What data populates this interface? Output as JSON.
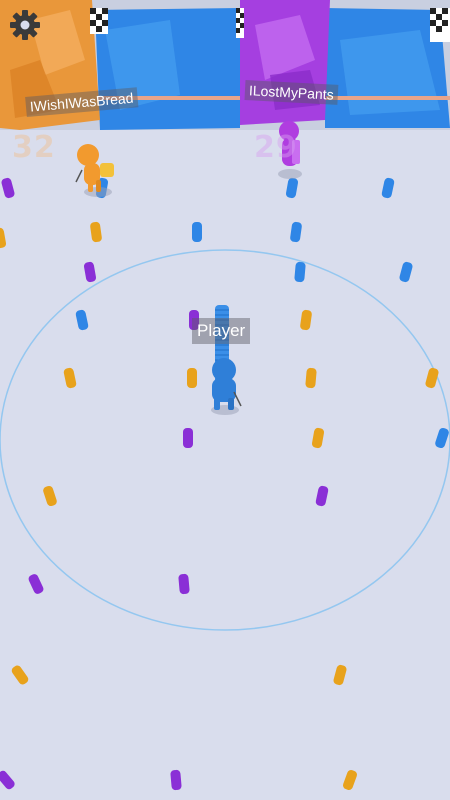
{
  "players": {
    "opponent_orange": {
      "name": "IWishIWasBread",
      "score": "32",
      "color": "#f29a2e"
    },
    "opponent_purple": {
      "name": "ILostMyPants",
      "score": "29",
      "color": "#b03de0"
    },
    "player": {
      "name": "Player",
      "color": "#3b8fe8"
    }
  },
  "colors": {
    "background": "#d9dded",
    "orange": "#e8a21c",
    "purple": "#8a2fd6",
    "blue": "#2f86e6",
    "wall_orange": "#e9973a",
    "wall_blue": "#2f86e6",
    "wall_purple": "#a53fe0",
    "ring": "#8cc4f0"
  },
  "hud": {
    "settings_icon": "gear-icon"
  }
}
